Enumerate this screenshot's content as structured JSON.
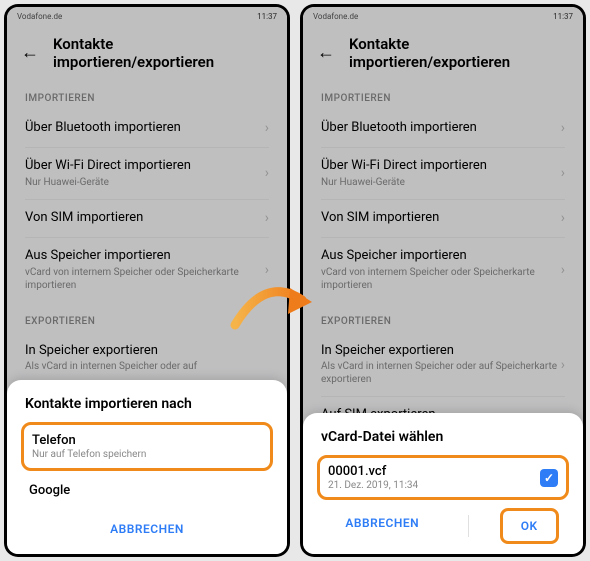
{
  "statusbar": {
    "carrier": "Vodafone.de",
    "time": "11:37"
  },
  "appbar": {
    "title": "Kontakte importieren/exportieren"
  },
  "sections": {
    "import_header": "IMPORTIEREN",
    "export_header": "EXPORTIEREN"
  },
  "rows": {
    "bluetooth": {
      "title": "Über Bluetooth importieren"
    },
    "wifi": {
      "title": "Über Wi-Fi Direct importieren",
      "sub": "Nur Huawei-Geräte"
    },
    "sim_import": {
      "title": "Von SIM importieren"
    },
    "storage_import": {
      "title": "Aus Speicher importieren",
      "sub": "vCard von internem Speicher oder Speicherkarte importieren"
    },
    "storage_export": {
      "title": "In Speicher exportieren",
      "sub": "Als vCard in internen Speicher oder auf"
    },
    "storage_export_full": {
      "title": "In Speicher exportieren",
      "sub": "Als vCard in internen Speicher oder auf Speicherkarte exportieren"
    },
    "sim_export": {
      "title": "Auf SIM exportieren"
    }
  },
  "sheet1": {
    "title": "Kontakte importieren nach",
    "option1": {
      "title": "Telefon",
      "sub": "Nur auf Telefon speichern"
    },
    "option2": {
      "title": "Google"
    },
    "cancel": "ABBRECHEN"
  },
  "sheet2": {
    "title": "vCard-Datei wählen",
    "file": {
      "name": "00001.vcf",
      "date": "21. Dez. 2019, 11:34"
    },
    "cancel": "ABBRECHEN",
    "ok": "OK"
  },
  "chevron": "›"
}
